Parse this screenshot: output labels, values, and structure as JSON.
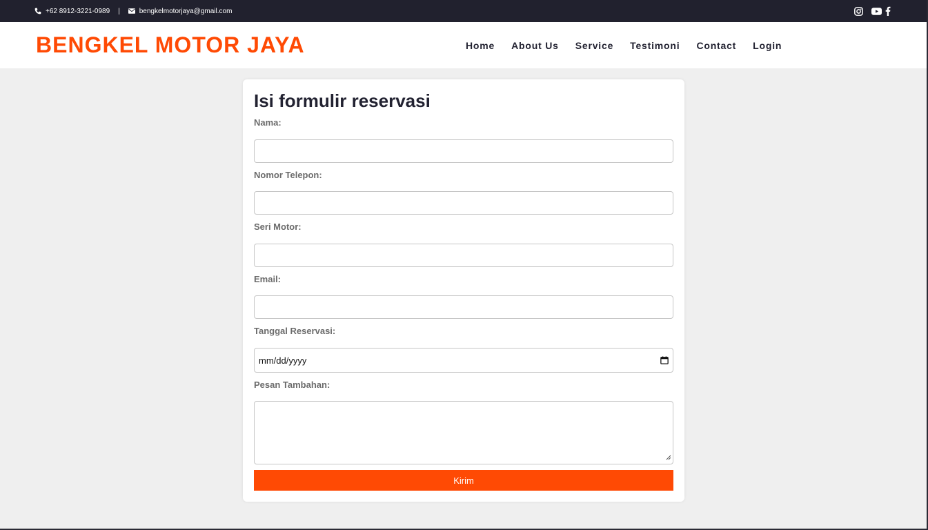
{
  "topbar": {
    "phone": "+62 8912-3221-0989",
    "separator": "|",
    "email": "bengkelmotorjaya@gmail.com",
    "icons": [
      "phone-icon",
      "mail-icon",
      "instagram-icon",
      "youtube-icon",
      "facebook-icon"
    ]
  },
  "header": {
    "logo": "BENGKEL MOTOR JAYA",
    "nav": [
      {
        "label": "Home"
      },
      {
        "label": "About Us"
      },
      {
        "label": "Service"
      },
      {
        "label": "Testimoni"
      },
      {
        "label": "Contact"
      },
      {
        "label": "Login"
      }
    ]
  },
  "form": {
    "title": "Isi formulir reservasi",
    "fields": {
      "nama": {
        "label": "Nama:",
        "value": ""
      },
      "telepon": {
        "label": "Nomor Telepon:",
        "value": ""
      },
      "seri_motor": {
        "label": "Seri Motor:",
        "value": ""
      },
      "email": {
        "label": "Email:",
        "value": ""
      },
      "tanggal": {
        "label": "Tanggal Reservasi:",
        "value": "mm/dd/yyyy"
      },
      "pesan": {
        "label": "Pesan Tambahan:",
        "value": ""
      }
    },
    "submit_label": "Kirim"
  },
  "colors": {
    "brand": "#ff4a04",
    "topbar": "#21212e",
    "nav_text": "#222231",
    "page_bg": "#efefef"
  }
}
